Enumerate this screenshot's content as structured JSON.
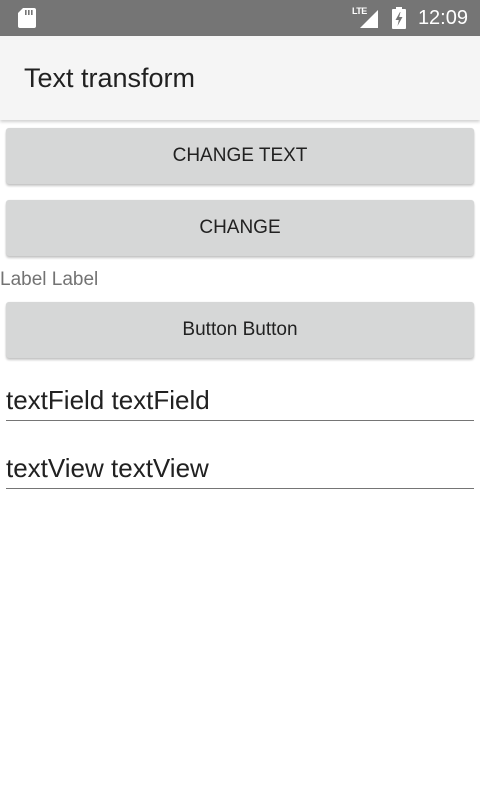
{
  "status_bar": {
    "time": "12:09",
    "network_label": "LTE",
    "icons": [
      "sd-card-icon",
      "signal-icon",
      "battery-charging-icon"
    ]
  },
  "app_bar": {
    "title": "Text transform"
  },
  "main": {
    "button_change_text": "CHANGE TEXT",
    "button_change": "CHANGE",
    "label": "Label Label",
    "button_button": "Button Button",
    "text_field_value": "textField textField",
    "text_view_value": "textView textView"
  },
  "colors": {
    "status_bar": "#757575",
    "app_bar": "#f5f5f5",
    "button_bg": "#d6d7d7",
    "label_text": "#737373",
    "primary_text": "#212121",
    "underline": "#757575"
  }
}
